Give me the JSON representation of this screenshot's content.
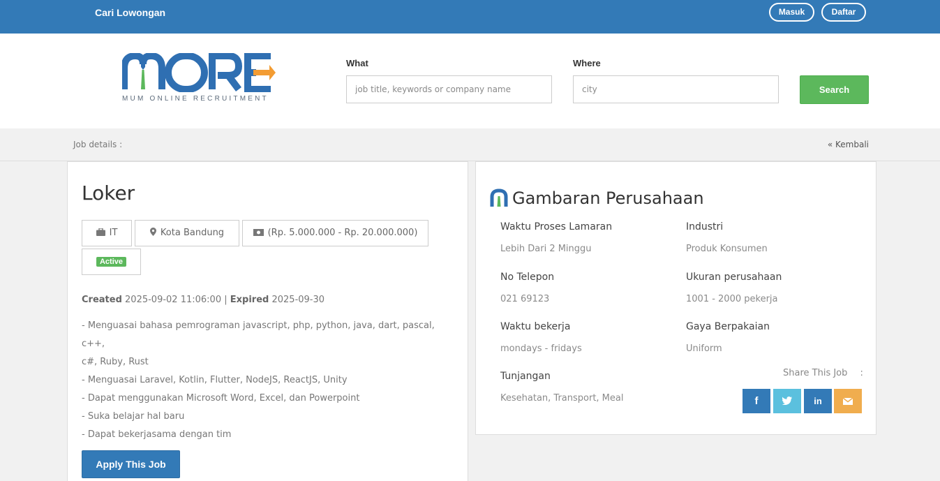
{
  "topbar": {
    "brand": "Cari Lowongan",
    "login": "Masuk",
    "register": "Daftar"
  },
  "logo": {
    "tagline": "MUM ONLINE RECRUITMENT",
    "icon": "more-logo"
  },
  "search": {
    "what_label": "What",
    "what_placeholder": "job title, keywords or company name",
    "where_label": "Where",
    "where_placeholder": "city",
    "button": "Search"
  },
  "breadcrumb": {
    "left": "Job details :",
    "back": "« Kembali"
  },
  "job": {
    "title": "Loker",
    "category": "IT",
    "location": "Kota Bandung",
    "salary": "(Rp. 5.000.000 - Rp. 20.000.000)",
    "status": "Active",
    "created_label": "Created",
    "created": "2025-09-02 11:06:00",
    "separator": "|",
    "expired_label": "Expired",
    "expired": "2025-09-30",
    "requirements": [
      "- Menguasai bahasa pemrograman javascript, php, python, java, dart, pascal, c++,",
      "c#, Ruby, Rust",
      "- Menguasai Laravel, Kotlin, Flutter, NodeJS, ReactJS, Unity",
      "- Dapat menggunakan Microsoft Word, Excel, dan Powerpoint",
      "- Suka belajar hal baru",
      "- Dapat bekerjasama dengan tim"
    ],
    "apply": "Apply This Job"
  },
  "company": {
    "title": "Gambaran Perusahaan",
    "fields": [
      {
        "label": "Waktu Proses Lamaran",
        "value": "Lebih Dari 2 Minggu"
      },
      {
        "label": "Industri",
        "value": "Produk Konsumen"
      },
      {
        "label": "No Telepon",
        "value": "021 69123"
      },
      {
        "label": "Ukuran perusahaan",
        "value": "1001 - 2000 pekerja"
      },
      {
        "label": "Waktu bekerja",
        "value": "mondays - fridays"
      },
      {
        "label": "Gaya Berpakaian",
        "value": "Uniform"
      },
      {
        "label": "Tunjangan",
        "value": "Kesehatan, Transport, Meal"
      }
    ],
    "share_label": "Share This Job",
    "share_colon": ":",
    "share_buttons": [
      {
        "icon": "facebook-icon",
        "glyph": "f",
        "color": "#337ab7"
      },
      {
        "icon": "twitter-icon",
        "glyph": "t",
        "color": "#5bc0de"
      },
      {
        "icon": "linkedin-icon",
        "glyph": "in",
        "color": "#337ab7"
      },
      {
        "icon": "email-icon",
        "glyph": "",
        "color": "#f0ad4e"
      }
    ]
  },
  "colors": {
    "primary": "#337ab7",
    "success": "#5cb85c",
    "logo_blue": "#2f6fb2",
    "logo_orange": "#f39c33",
    "logo_green": "#5cb85c"
  }
}
